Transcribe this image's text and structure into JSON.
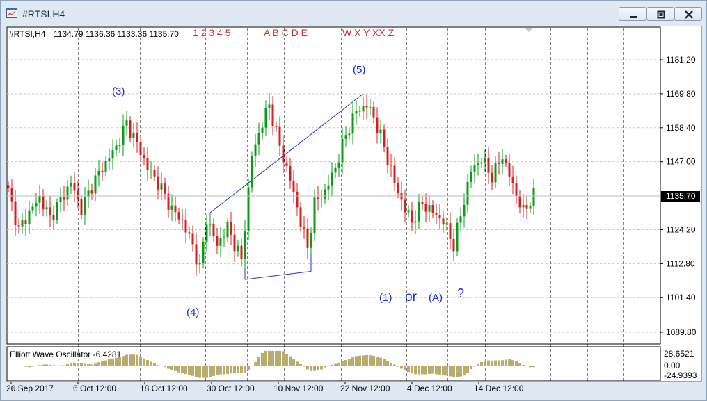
{
  "window": {
    "title": "#RTSI,H4",
    "minimize_icon": "minimize-icon",
    "restore_icon": "restore-icon",
    "close_icon": "close-icon"
  },
  "chart_header": {
    "symbol": "#RTSI,H4",
    "ohlc": "1134.79 1136.36 1133.36 1135.70",
    "wave_legend_numbers": "1 2 3 4 5",
    "wave_legend_letters": "A B C D E",
    "wave_legend_complex": "W X Y XX Z"
  },
  "colors": {
    "bull_candle": "#0a9c18",
    "bear_candle": "#d42020",
    "wave_labels": "#1a2fc8",
    "legend_text": "#cc3030",
    "oscillator": "#b8ad6e"
  },
  "annotations": {
    "wave_3": "(3)",
    "wave_4": "(4)",
    "wave_5": "(5)",
    "wave_1": "(1)",
    "or_text": "or",
    "wave_A": "(A)",
    "question": "?"
  },
  "current_price_label": "1135.70",
  "oscillator": {
    "name": "Elliott Wave Oscillator -6.4281",
    "axis_labels": [
      "28.6521",
      "0.00",
      "-24.9393"
    ]
  },
  "chart_data": {
    "type": "candlestick",
    "price_axis_labels": [
      "1181.20",
      "1169.80",
      "1158.40",
      "1147.00",
      "1135.70",
      "1124.20",
      "1112.80",
      "1101.40",
      "1089.80"
    ],
    "time_axis_labels": [
      "26 Sep 2017",
      "6 Oct 12:00",
      "18 Oct 12:00",
      "30 Oct 12:00",
      "10 Nov 12:00",
      "22 Nov 12:00",
      "4 Dec 12:00",
      "14 Dec 12:00"
    ],
    "ylim": [
      1084,
      1190
    ],
    "anchors": [
      [
        0,
        1137
      ],
      [
        3,
        1124
      ],
      [
        6,
        1130
      ],
      [
        9,
        1135
      ],
      [
        12,
        1128
      ],
      [
        15,
        1134
      ],
      [
        18,
        1140
      ],
      [
        21,
        1131
      ],
      [
        24,
        1139
      ],
      [
        27,
        1145
      ],
      [
        31,
        1152
      ],
      [
        34,
        1160
      ],
      [
        37,
        1153
      ],
      [
        40,
        1145
      ],
      [
        43,
        1140
      ],
      [
        47,
        1131
      ],
      [
        50,
        1127
      ],
      [
        53,
        1119
      ],
      [
        55,
        1111
      ],
      [
        57,
        1128
      ],
      [
        60,
        1119
      ],
      [
        63,
        1125
      ],
      [
        67,
        1114
      ],
      [
        70,
        1149
      ],
      [
        73,
        1160
      ],
      [
        75,
        1166
      ],
      [
        78,
        1152
      ],
      [
        81,
        1141
      ],
      [
        84,
        1127
      ],
      [
        86,
        1118
      ],
      [
        88,
        1133
      ],
      [
        91,
        1137
      ],
      [
        94,
        1145
      ],
      [
        97,
        1156
      ],
      [
        100,
        1164
      ],
      [
        103,
        1166
      ],
      [
        105,
        1162
      ],
      [
        108,
        1152
      ],
      [
        111,
        1140
      ],
      [
        114,
        1131
      ],
      [
        116,
        1127
      ],
      [
        119,
        1133
      ],
      [
        122,
        1130
      ],
      [
        125,
        1127
      ],
      [
        128,
        1119
      ],
      [
        130,
        1129
      ],
      [
        133,
        1144
      ],
      [
        136,
        1148
      ],
      [
        139,
        1142
      ],
      [
        142,
        1149
      ],
      [
        145,
        1139
      ],
      [
        148,
        1130
      ],
      [
        151,
        1136
      ]
    ],
    "wave_lines": [
      [
        [
          1129.9,
          1132.4
        ],
        [
          1169.8,
          1171
        ]
      ],
      [
        [
          1107.5,
          1108
        ],
        [
          1110.2,
          1109.6
        ]
      ]
    ]
  }
}
